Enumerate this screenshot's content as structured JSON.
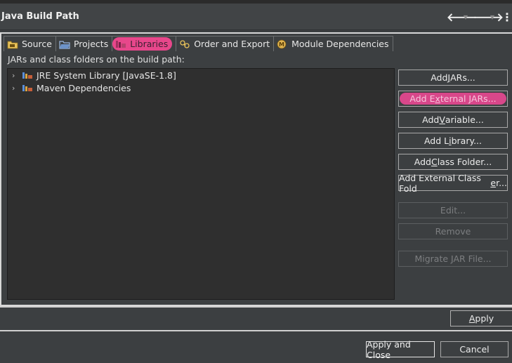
{
  "window": {
    "title": "Java Build Path"
  },
  "tabs": [
    {
      "label": "Source",
      "icon": "source-folder-icon"
    },
    {
      "label": "Projects",
      "icon": "projects-folder-icon"
    },
    {
      "label": "Libraries",
      "icon": "libraries-icon",
      "active": true
    },
    {
      "label": "Order and Export",
      "icon": "order-export-icon"
    },
    {
      "label": "Module Dependencies",
      "icon": "module-icon"
    }
  ],
  "description": "JARs and class folders on the build path:",
  "tree": [
    {
      "label": "JRE System Library [JavaSE-1.8]",
      "icon": "library-icon"
    },
    {
      "label": "Maven Dependencies",
      "icon": "library-icon"
    }
  ],
  "buttons": {
    "add_jars": {
      "pre": "Add ",
      "mn": "J",
      "post": "ARs..."
    },
    "add_external_jars": {
      "pre": "Add E",
      "mn": "x",
      "post": "ternal JARs..."
    },
    "add_variable": {
      "pre": "Add ",
      "mn": "V",
      "post": "ariable..."
    },
    "add_library": {
      "pre": "Add L",
      "mn": "i",
      "post": "brary..."
    },
    "add_class_folder": {
      "pre": "Add ",
      "mn": "C",
      "post": "lass Folder..."
    },
    "add_external_class_folder": {
      "pre": "Add External Class Fold",
      "mn": "e",
      "post": "r..."
    },
    "edit": "Edit...",
    "remove": "Remove",
    "migrate": "Migrate JAR File..."
  },
  "footer": {
    "apply": {
      "mn": "A",
      "post": "pply"
    },
    "apply_and_close": "Apply and Close",
    "cancel": "Cancel"
  },
  "colors": {
    "highlight": "#e8478b",
    "background": "#3c3f41",
    "tree_bg": "#2f2f2f"
  }
}
